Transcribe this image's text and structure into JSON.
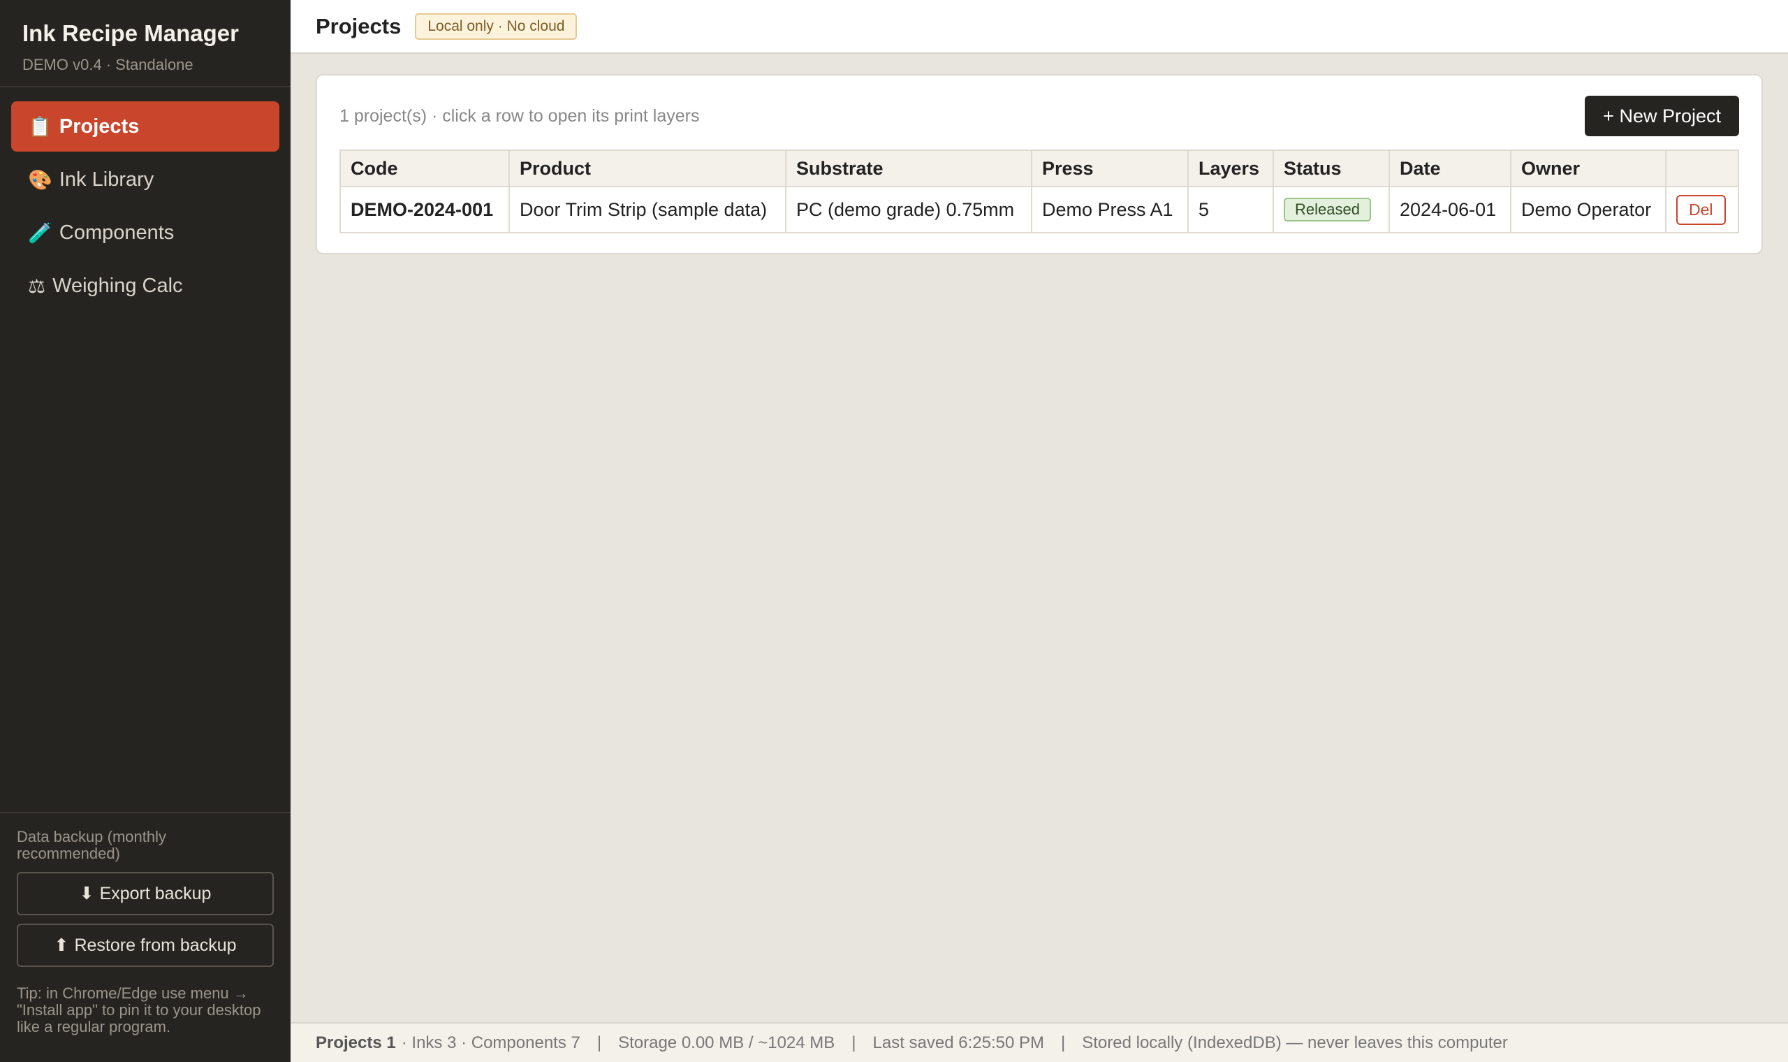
{
  "app": {
    "title": "Ink Recipe Manager",
    "subtitle": "DEMO v0.4 · Standalone"
  },
  "sidebar": {
    "items": [
      {
        "icon": "📋",
        "icon_name": "clipboard-icon",
        "label": "Projects",
        "active": true
      },
      {
        "icon": "🎨",
        "icon_name": "palette-icon",
        "label": "Ink Library",
        "active": false
      },
      {
        "icon": "🧪",
        "icon_name": "test-tube-icon",
        "label": "Components",
        "active": false
      },
      {
        "icon": "⚖",
        "icon_name": "scale-icon",
        "label": "Weighing Calc",
        "active": false
      }
    ],
    "backup_label": "Data backup (monthly recommended)",
    "export_icon": "⬇",
    "export_label": "Export backup",
    "restore_icon": "⬆",
    "restore_label": "Restore from backup",
    "tip": "Tip: in Chrome/Edge use menu → \"Install app\" to pin it to your desktop like a regular program."
  },
  "header": {
    "title": "Projects",
    "badge": "Local only · No cloud"
  },
  "projects": {
    "summary": "1 project(s) · click a row to open its print layers",
    "new_button": "+ New Project",
    "columns": [
      "Code",
      "Product",
      "Substrate",
      "Press",
      "Layers",
      "Status",
      "Date",
      "Owner",
      ""
    ],
    "rows": [
      {
        "code": "DEMO-2024-001",
        "product": "Door Trim Strip (sample data)",
        "substrate": "PC (demo grade) 0.75mm",
        "press": "Demo Press A1",
        "layers": "5",
        "status": "Released",
        "date": "2024-06-01",
        "owner": "Demo Operator",
        "delete_label": "Del"
      }
    ]
  },
  "statusbar": {
    "projects": "Projects 1",
    "rest": "· Inks 3 · Components 7",
    "separator": "|",
    "storage": "Storage 0.00 MB / ~1024 MB",
    "last_saved": "Last saved 6:25:50 PM",
    "stored": "Stored locally (IndexedDB) — never leaves this computer"
  },
  "colors": {
    "accent": "#c9452c",
    "sidebar_bg": "#262420",
    "status_released_bg": "#e3f1dc",
    "badge_bg": "#fdf2dc"
  }
}
